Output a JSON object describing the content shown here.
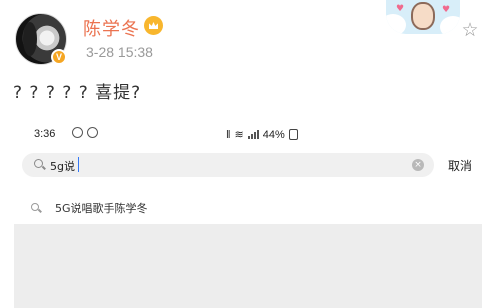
{
  "post": {
    "username": "陈学冬",
    "verified_badge": "V",
    "timestamp": "3-28 15:38",
    "text": "? ? ? ? ?  喜提?",
    "icons": {
      "avatar": "avatar-image",
      "member": "crown-icon",
      "star": "star-outline-icon",
      "card": "card-art-image"
    }
  },
  "screenshot": {
    "status_bar": {
      "time": "3:36",
      "battery": "44%",
      "icons": [
        "vibrate-icon",
        "wifi-icon",
        "signal-icon",
        "battery-icon"
      ]
    },
    "search": {
      "value": "5g说",
      "cancel_label": "取消"
    },
    "suggestions": [
      {
        "label": "5G说唱歌手陈学冬"
      }
    ]
  },
  "colors": {
    "username": "#eb7350",
    "timestamp": "#999999",
    "badge": "#f5a623",
    "search_bg": "#f0f0f0",
    "empty_panel": "#ededed"
  }
}
